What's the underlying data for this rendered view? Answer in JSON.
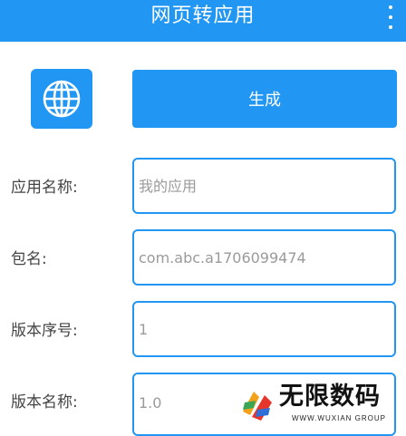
{
  "appbar": {
    "title": "网页转应用",
    "menu_icon": "more-vert-icon"
  },
  "generate": {
    "icon": "globe-icon",
    "label": "生成"
  },
  "form": {
    "app_name": {
      "label": "应用名称:",
      "placeholder": "我的应用",
      "value": ""
    },
    "package": {
      "label": "包名:",
      "placeholder": "com.abc.a1706099474",
      "value": ""
    },
    "version_code": {
      "label": "版本序号:",
      "placeholder": "1",
      "value": ""
    },
    "version_name": {
      "label": "版本名称:",
      "placeholder": "1.0",
      "value": ""
    }
  },
  "watermark": {
    "text": "无限数码",
    "sub": "WWW.WUXIAN GROUP"
  },
  "colors": {
    "accent": "#2196f3",
    "background": "#ffffff"
  }
}
